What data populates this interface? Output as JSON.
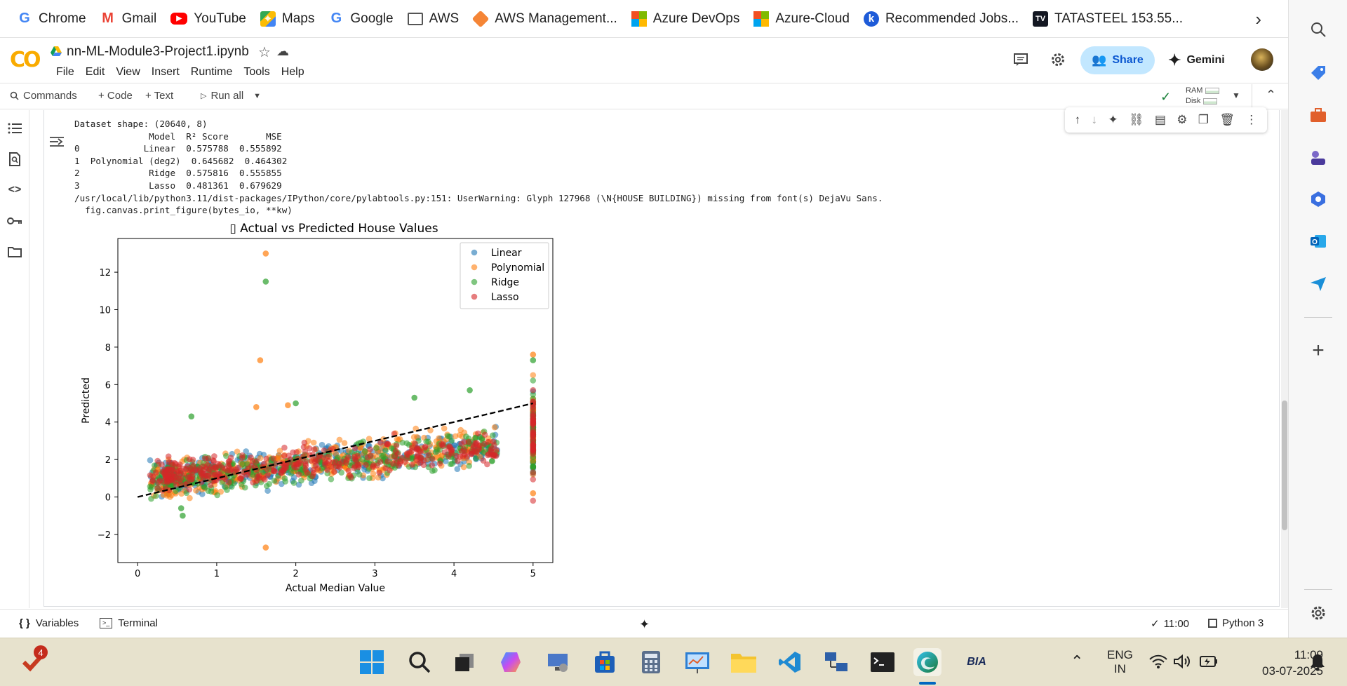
{
  "browser": {
    "bookmarks": [
      {
        "label": "Chrome",
        "icon": "google-icon",
        "color": "#4285f4"
      },
      {
        "label": "Gmail",
        "icon": "gmail-icon",
        "color": "#ea4335"
      },
      {
        "label": "YouTube",
        "icon": "youtube-icon",
        "color": "#ff0000"
      },
      {
        "label": "Maps",
        "icon": "maps-icon",
        "color": "#34a853"
      },
      {
        "label": "Google",
        "icon": "google-icon",
        "color": "#4285f4"
      },
      {
        "label": "AWS",
        "icon": "folder-icon",
        "color": "#555555"
      },
      {
        "label": "AWS Management...",
        "icon": "aws-icon",
        "color": "#f58536"
      },
      {
        "label": "Azure DevOps",
        "icon": "microsoft-icon",
        "color": "#f25022"
      },
      {
        "label": "Azure-Cloud",
        "icon": "microsoft-icon",
        "color": "#f25022"
      },
      {
        "label": "Recommended Jobs...",
        "icon": "jobs-icon",
        "color": "#1e5bd8"
      },
      {
        "label": "TATASTEEL 153.55...",
        "icon": "tradingview-icon",
        "color": "#131722"
      }
    ]
  },
  "colab": {
    "logo": "CO",
    "notebook_title": "nn-ML-Module3-Project1.ipynb",
    "menu": [
      "File",
      "Edit",
      "View",
      "Insert",
      "Runtime",
      "Tools",
      "Help"
    ],
    "share_label": "Share",
    "gemini_label": "Gemini",
    "toolbar": {
      "commands": "Commands",
      "code": "+ Code",
      "text": "+ Text",
      "run_all": "Run all",
      "ram": "RAM",
      "disk": "Disk"
    },
    "output_lines": [
      "Dataset shape: (20640, 8)",
      "              Model  R² Score       MSE",
      "0            Linear  0.575788  0.555892",
      "1  Polynomial (deg2)  0.645682  0.464302",
      "2             Ridge  0.575816  0.555855",
      "3             Lasso  0.481361  0.679629",
      "/usr/local/lib/python3.11/dist-packages/IPython/core/pylabtools.py:151: UserWarning: Glyph 127968 (\\N{HOUSE BUILDING}) missing from font(s) DejaVu Sans.",
      "  fig.canvas.print_figure(bytes_io, **kw)"
    ],
    "status": {
      "variables": "Variables",
      "terminal": "Terminal",
      "exec_time": "11:00",
      "kernel": "Python 3"
    }
  },
  "chart_data": {
    "type": "scatter",
    "title": "▯ Actual vs Predicted House Values",
    "xlabel": "Actual Median Value",
    "ylabel": "Predicted",
    "xlim": [
      -0.25,
      5.25
    ],
    "ylim": [
      -3.5,
      13.8
    ],
    "xticks": [
      0,
      1,
      2,
      3,
      4,
      5
    ],
    "yticks": [
      -2,
      0,
      2,
      4,
      6,
      8,
      10,
      12
    ],
    "grid": false,
    "legend_position": "upper right",
    "reference_line": {
      "style": "dashed",
      "color": "#000000",
      "points": [
        [
          0,
          0
        ],
        [
          5,
          5
        ]
      ]
    },
    "series": [
      {
        "name": "Linear",
        "color": "#1f77b4",
        "trend": {
          "slope": 0.42,
          "intercept": 0.83,
          "spread": 0.45
        }
      },
      {
        "name": "Polynomial",
        "color": "#ff7f0e",
        "trend": {
          "slope": 0.5,
          "intercept": 0.65,
          "spread": 0.5
        },
        "outliers": [
          [
            1.62,
            13.0
          ],
          [
            1.55,
            7.3
          ],
          [
            1.62,
            -2.7
          ],
          [
            5.0,
            7.6
          ],
          [
            1.5,
            4.8
          ],
          [
            1.9,
            4.9
          ],
          [
            5.0,
            0.2
          ]
        ]
      },
      {
        "name": "Ridge",
        "color": "#2ca02c",
        "trend": {
          "slope": 0.42,
          "intercept": 0.83,
          "spread": 0.45
        },
        "outliers": [
          [
            1.62,
            11.5
          ],
          [
            0.55,
            -0.6
          ],
          [
            0.57,
            -1.0
          ],
          [
            0.68,
            4.3
          ],
          [
            2.0,
            5.0
          ],
          [
            5.0,
            7.3
          ],
          [
            3.5,
            5.3
          ],
          [
            4.2,
            5.7
          ]
        ]
      },
      {
        "name": "Lasso",
        "color": "#d62728",
        "trend": {
          "slope": 0.34,
          "intercept": 1.05,
          "spread": 0.4
        }
      }
    ]
  },
  "taskbar": {
    "notification_badge": "4",
    "language_line1": "ENG",
    "language_line2": "IN",
    "time": "11:09",
    "date": "03-07-2025",
    "app_label_bia": "BIA"
  }
}
